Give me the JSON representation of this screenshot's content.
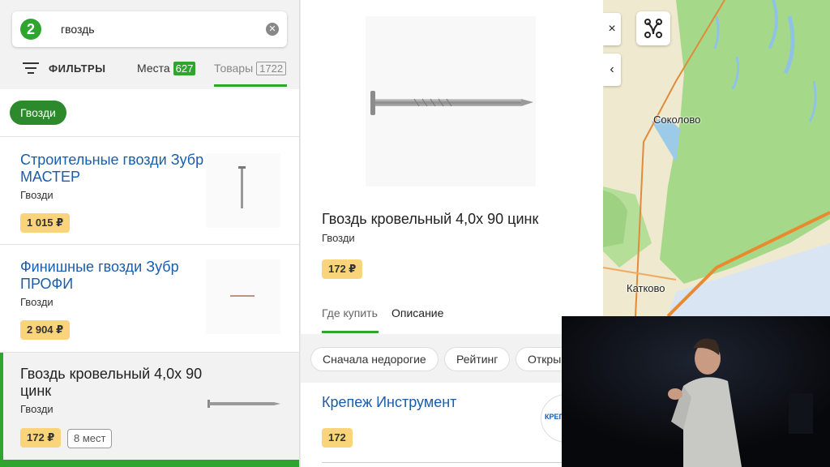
{
  "search": {
    "logo_text": "2",
    "query": "гвоздь"
  },
  "filters": {
    "label": "ФИЛЬТРЫ"
  },
  "tabs": [
    {
      "label": "Места",
      "count": "627"
    },
    {
      "label": "Товары",
      "count": "1722"
    }
  ],
  "category_chip": "Гвозди",
  "results": [
    {
      "title": "Строительные гвозди Зубр МАСТЕР",
      "category": "Гвозди",
      "price": "1 015 ₽"
    },
    {
      "title": "Финишные гвозди Зубр ПРОФИ",
      "category": "Гвозди",
      "price": "2 904 ₽"
    },
    {
      "title": "Гвоздь кровельный 4,0х 90 цинк",
      "category": "Гвозди",
      "price": "172 ₽",
      "places": "8 мест"
    }
  ],
  "product": {
    "title": "Гвоздь кровельный 4,0х 90 цинк",
    "category": "Гвозди",
    "price": "172 ₽",
    "tabs": [
      "Где купить",
      "Описание"
    ],
    "sort_options": [
      "Сначала недорогие",
      "Рейтинг",
      "Откры"
    ],
    "seller": {
      "name": "Крепеж Инструмент",
      "price": "172",
      "logo_text": "КРЕП ИНСТ"
    }
  },
  "map": {
    "close_symbol": "×",
    "collapse_symbol": "‹",
    "labels": [
      "Соколово",
      "Катково"
    ]
  }
}
